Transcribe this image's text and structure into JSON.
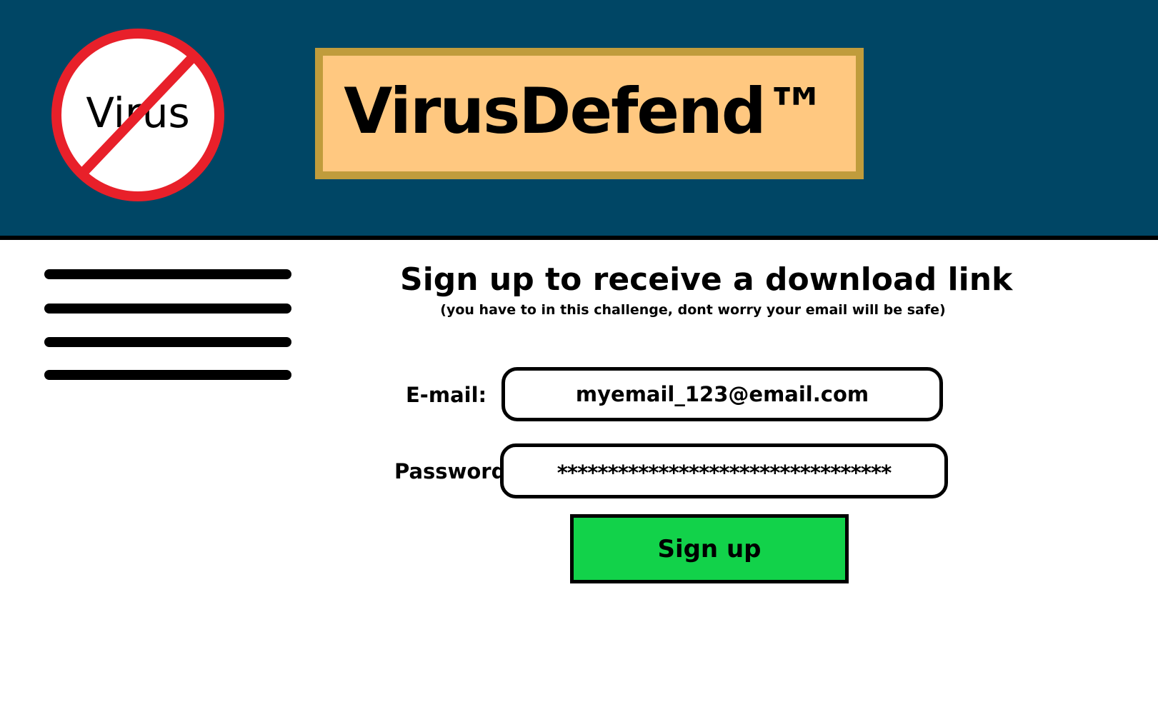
{
  "header": {
    "logo_text": "Virus",
    "brand_title": "VirusDefend™",
    "colors": {
      "header_bg": "#004665",
      "brand_border": "#c09c3c",
      "brand_fill": "#ffc880",
      "logo_ring": "#e8202a"
    }
  },
  "menu": {
    "icon": "hamburger-menu-icon"
  },
  "form": {
    "heading": "Sign up to receive a download link",
    "subheading": "(you have to in this challenge, dont worry your email will be safe)",
    "email_label": "E-mail:",
    "email_value": "myemail_123@email.com",
    "password_label": "Password:",
    "password_value": "*********************************",
    "signup_label": "Sign up",
    "signup_color": "#12d24a"
  }
}
